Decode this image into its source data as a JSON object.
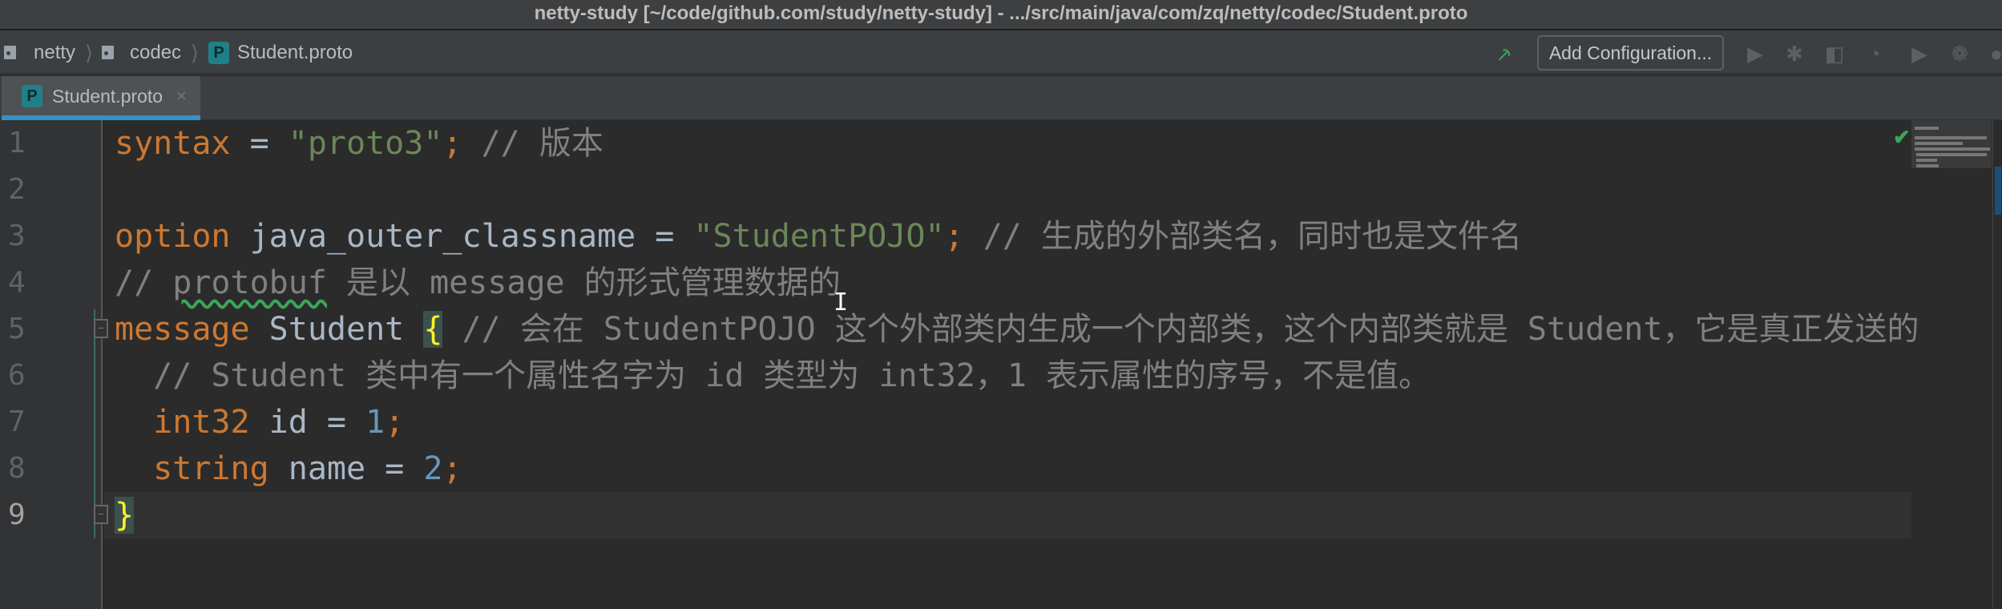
{
  "window": {
    "title": "netty-study [~/code/github.com/study/netty-study] - .../src/main/java/com/zq/netty/codec/Student.proto"
  },
  "breadcrumb": {
    "items": [
      {
        "label": "netty",
        "icon": "folder-icon"
      },
      {
        "label": "codec",
        "icon": "folder-icon"
      },
      {
        "label": "Student.proto",
        "icon": "proto-file-icon",
        "icon_letter": "P"
      }
    ]
  },
  "toolbar": {
    "add_configuration": "Add Configuration...",
    "icons": [
      "build-hammer-icon",
      "run-icon",
      "debug-icon",
      "coverage-icon",
      "profile-icon",
      "run-alt-icon",
      "attach-icon",
      "stop-icon"
    ]
  },
  "tabs": [
    {
      "label": "Student.proto",
      "icon_letter": "P",
      "active": true,
      "close": "×"
    }
  ],
  "editor": {
    "line_numbers": [
      "1",
      "2",
      "3",
      "4",
      "5",
      "6",
      "7",
      "8",
      "9"
    ],
    "current_line": 9,
    "lines": [
      [
        {
          "t": "syntax",
          "c": "kw"
        },
        {
          "t": " = "
        },
        {
          "t": "\"proto3\"",
          "c": "str"
        },
        {
          "t": ";",
          "c": "kw"
        },
        {
          "t": " // 版本",
          "c": "cm"
        }
      ],
      [],
      [
        {
          "t": "option",
          "c": "kw"
        },
        {
          "t": " java_outer_classname = "
        },
        {
          "t": "\"StudentPOJO\"",
          "c": "str"
        },
        {
          "t": ";",
          "c": "kw"
        },
        {
          "t": " // 生成的外部类名，同时也是文件名",
          "c": "cm"
        }
      ],
      [
        {
          "t": "// ",
          "c": "cm"
        },
        {
          "t": "protobuf",
          "c": "cm squig"
        },
        {
          "t": " 是以 message 的形式管理数据的",
          "c": "cm"
        }
      ],
      [
        {
          "t": "message",
          "c": "kw"
        },
        {
          "t": " Student "
        },
        {
          "t": "{",
          "c": "br"
        },
        {
          "t": " // 会在 StudentPOJO 这个外部类内生成一个内部类，这个内部类就是 Student，它是真正发送的",
          "c": "cm"
        }
      ],
      [
        {
          "t": "  // Student 类中有一个属性名字为 id 类型为 int32，1 表示属性的序号，不是值。",
          "c": "cm"
        }
      ],
      [
        {
          "t": "  "
        },
        {
          "t": "int32",
          "c": "kw"
        },
        {
          "t": " id = "
        },
        {
          "t": "1",
          "c": "num"
        },
        {
          "t": ";",
          "c": "kw"
        }
      ],
      [
        {
          "t": "  "
        },
        {
          "t": "string",
          "c": "kw"
        },
        {
          "t": " name = "
        },
        {
          "t": "2",
          "c": "num"
        },
        {
          "t": ";",
          "c": "kw"
        }
      ],
      [
        {
          "t": "}",
          "c": "br"
        }
      ]
    ]
  },
  "colors": {
    "keyword": "#cc7832",
    "string": "#6a8759",
    "comment": "#808080",
    "number": "#6897bb",
    "brace_match": "#ffef28",
    "accent": "#3592c4"
  }
}
